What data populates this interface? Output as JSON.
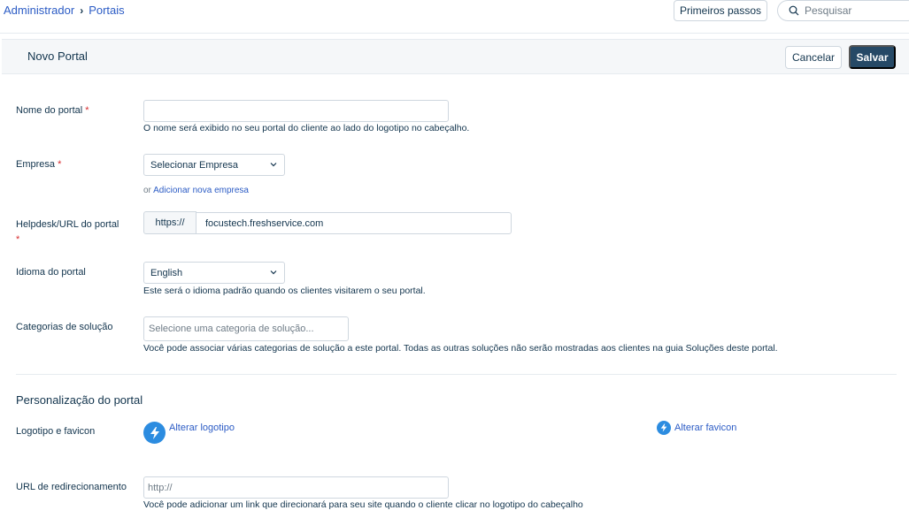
{
  "breadcrumb": {
    "root": "Administrador",
    "current": "Portais"
  },
  "topbar": {
    "getting_started": "Primeiros passos",
    "search_placeholder": "Pesquisar"
  },
  "header": {
    "title": "Novo Portal",
    "cancel_label": "Cancelar",
    "save_label": "Salvar"
  },
  "form": {
    "portal_name": {
      "label": "Nome do portal",
      "required_mark": "*",
      "value": "",
      "hint": "O nome será exibido no seu portal do cliente ao lado do logotipo no cabeçalho."
    },
    "company": {
      "label": "Empresa",
      "required_mark": "*",
      "selected": "Selecionar Empresa",
      "link_prefix": "or",
      "link_label": "Adicionar nova empresa"
    },
    "helpdesk_url": {
      "label": "Helpdesk/URL do portal",
      "required_mark": "*",
      "prefix": "https://",
      "value": "focustech.freshservice.com"
    },
    "language": {
      "label": "Idioma do portal",
      "selected": "English",
      "hint": "Este será o idioma padrão quando os clientes visitarem o seu portal."
    },
    "solution_categories": {
      "label": "Categorias de solução",
      "placeholder": "Selecione uma categoria de solução...",
      "hint": "Você pode associar várias categorias de solução a este portal. Todas as outras soluções não serão mostradas aos clientes na guia Soluções deste portal."
    }
  },
  "customization": {
    "title": "Personalização do portal",
    "logo_label": "Logotipo e favicon",
    "change_logo": "Alterar logotipo",
    "change_favicon": "Alterar favicon",
    "redirect_label": "URL de redirecionamento",
    "redirect_placeholder": "http://",
    "redirect_hint": "Você pode adicionar um link que direcionará para seu site quando o cliente clicar no logotipo do cabeçalho"
  },
  "colors": {
    "primary_button": "#264966",
    "link": "#2c5cc5",
    "required": "#d72d30",
    "logo_badge": "#2c8ce0"
  },
  "icons": [
    "chevron-right-icon",
    "search-icon",
    "chevron-down-icon",
    "bolt-icon"
  ]
}
